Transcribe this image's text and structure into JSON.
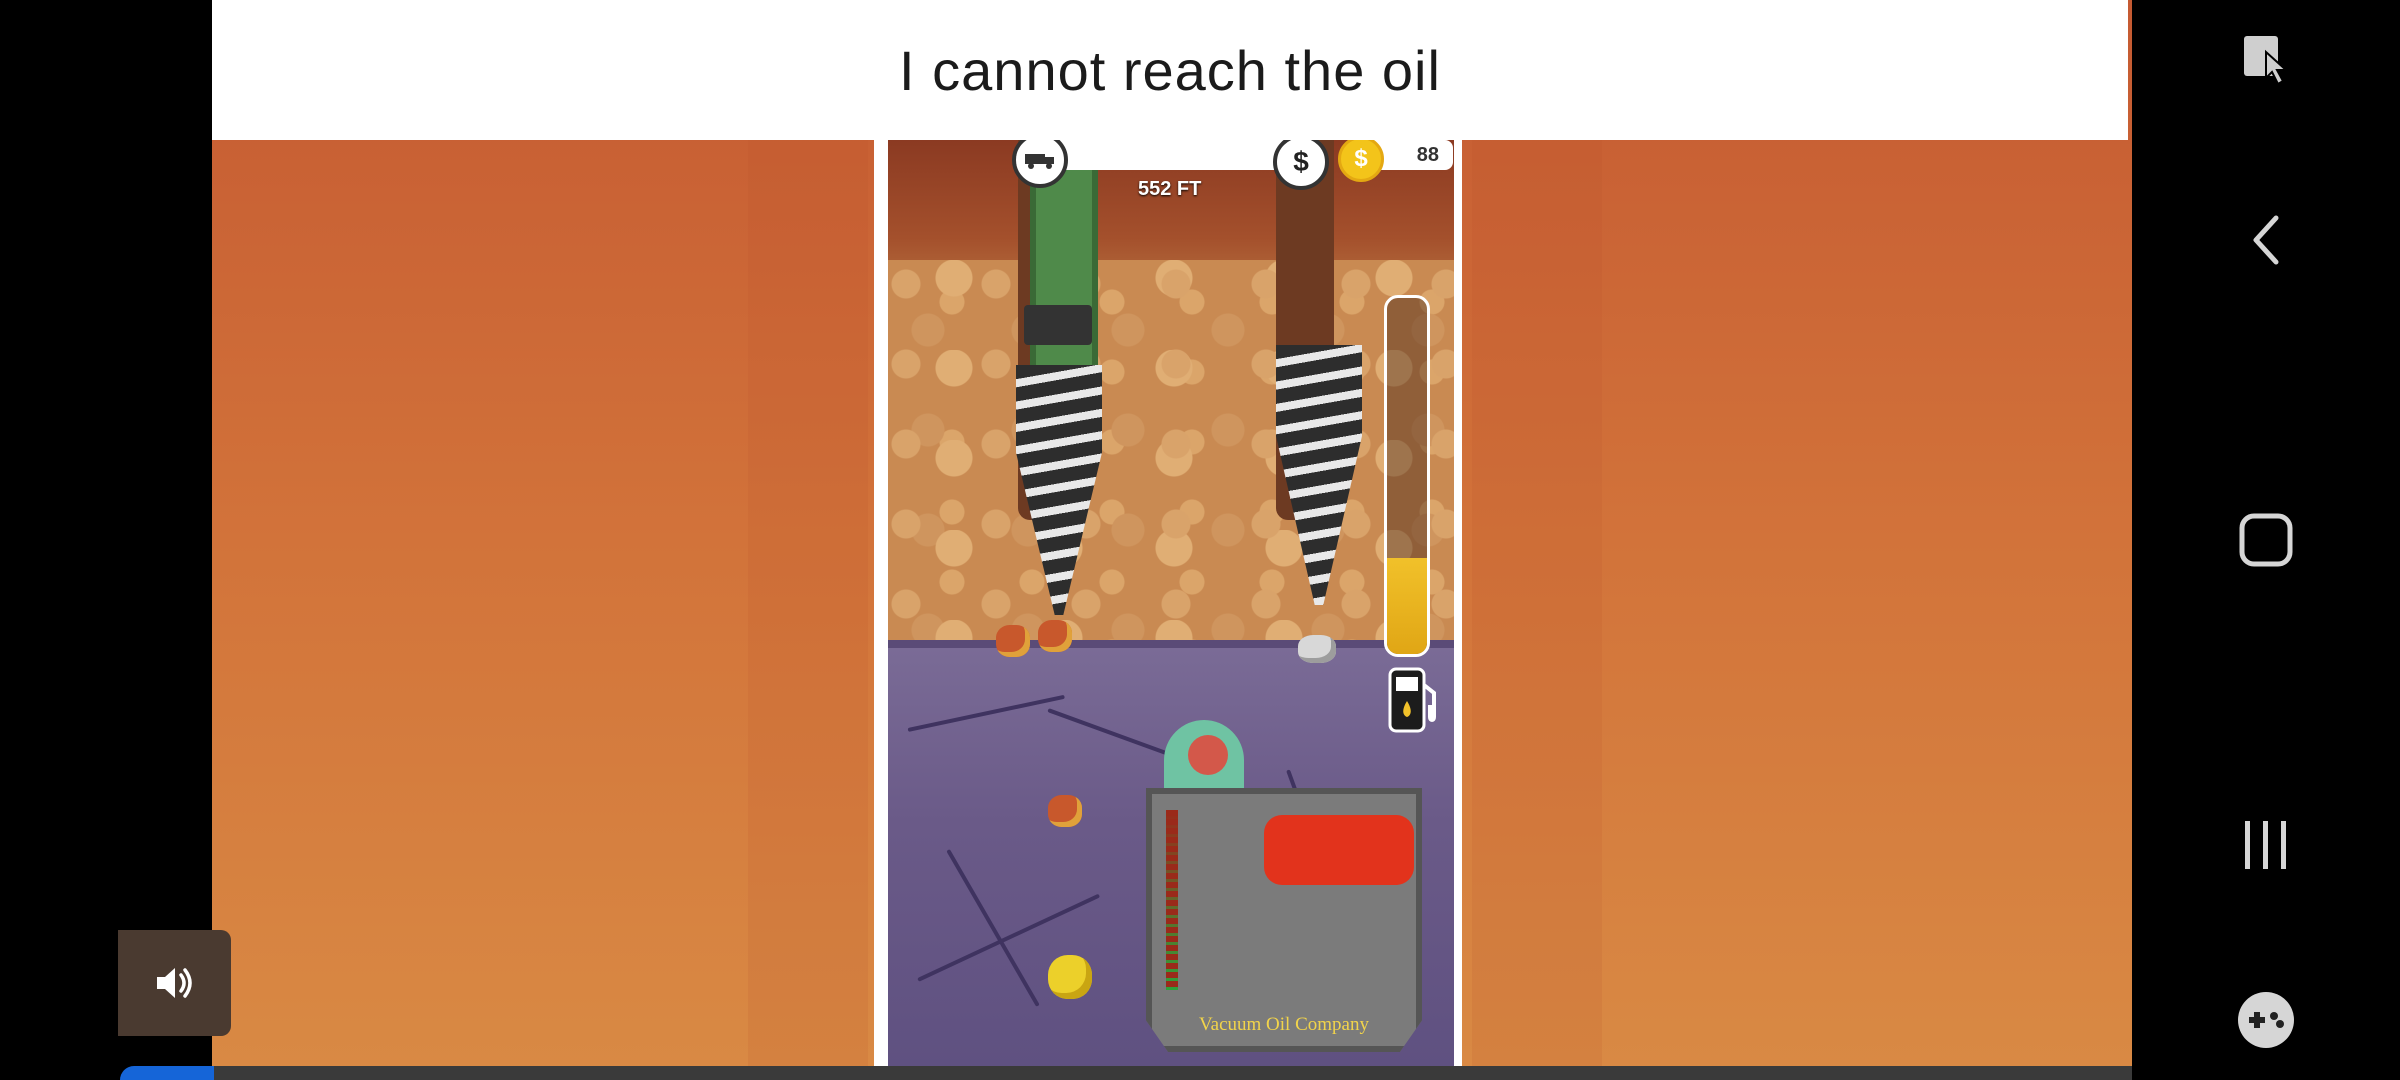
{
  "caption": "I cannot reach the oil",
  "hud": {
    "depth": "552 FT",
    "coins": "88",
    "coin_symbol": "$",
    "money_symbol": "$"
  },
  "oil_level": 0.27,
  "machine_label": "Vacuum Oil Company",
  "nav": {
    "icons": [
      "screen-pin-icon",
      "back-icon",
      "home-icon",
      "recents-icon",
      "game-tools-icon"
    ]
  },
  "colors": {
    "oil": "#f1c12a",
    "accent": "#1565d8"
  }
}
